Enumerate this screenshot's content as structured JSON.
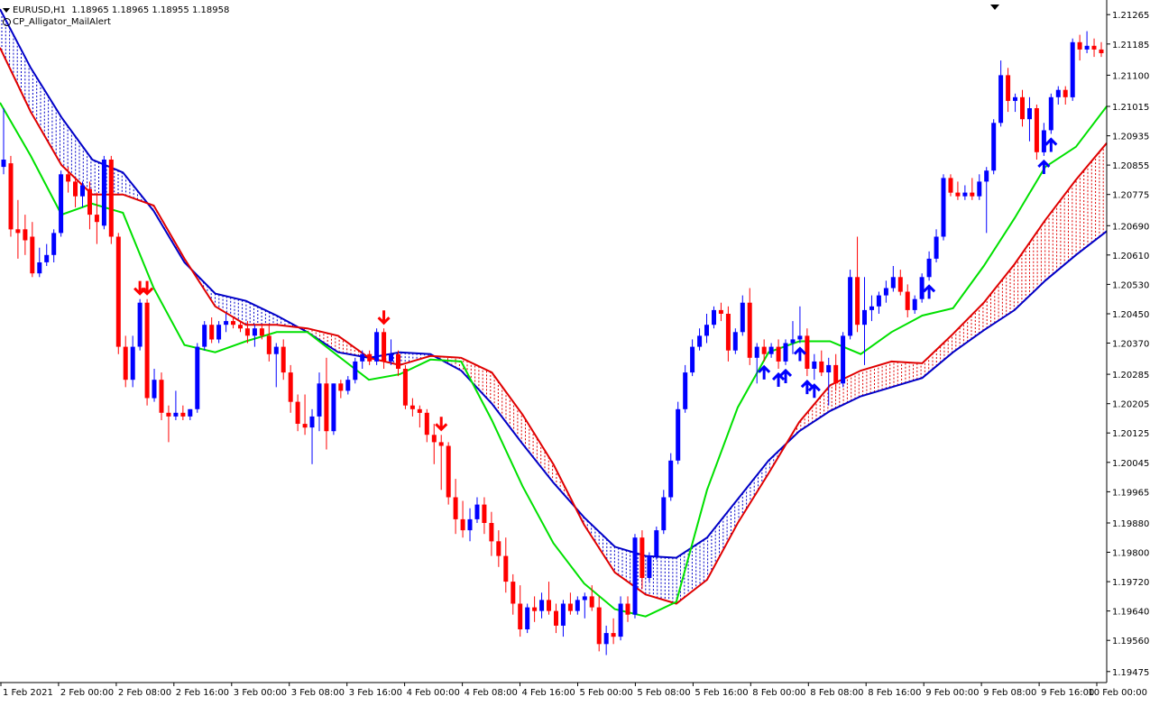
{
  "header": {
    "symbol_line": "EURUSD,H1  1.18965 1.18965 1.18955 1.18958",
    "indicator_name": "CP_Alligator_MailAlert"
  },
  "colors": {
    "bull_candle": "#0000ff",
    "bear_candle": "#ff0000",
    "jaw": "#0000c8",
    "teeth": "#e00000",
    "lips": "#00e000",
    "arrow_down": "#ff0000",
    "arrow_up": "#0000ff",
    "axis": "#000000"
  },
  "chart_data": {
    "type": "candlestick",
    "symbol": "EURUSD",
    "timeframe": "H1",
    "ylim": [
      1.19445,
      1.213
    ],
    "y_ticks": [
      "1.21265",
      "1.21185",
      "1.21100",
      "1.21015",
      "1.20935",
      "1.20855",
      "1.20775",
      "1.20690",
      "1.20610",
      "1.20530",
      "1.20450",
      "1.20370",
      "1.20285",
      "1.20205",
      "1.20125",
      "1.20045",
      "1.19965",
      "1.19880",
      "1.19800",
      "1.19720",
      "1.19640",
      "1.19560",
      "1.19475"
    ],
    "x_ticks": [
      "1 Feb 2021",
      "2 Feb 00:00",
      "2 Feb 08:00",
      "2 Feb 16:00",
      "3 Feb 00:00",
      "3 Feb 08:00",
      "3 Feb 16:00",
      "4 Feb 00:00",
      "4 Feb 08:00",
      "4 Feb 16:00",
      "5 Feb 00:00",
      "5 Feb 08:00",
      "5 Feb 16:00",
      "8 Feb 00:00",
      "8 Feb 08:00",
      "8 Feb 16:00",
      "9 Feb 00:00",
      "9 Feb 08:00",
      "9 Feb 16:00",
      "10 Feb 00:00"
    ],
    "series": [
      {
        "name": "Jaw",
        "values": [
          1.2128,
          1.2112,
          1.20985,
          1.2087,
          1.20835,
          1.2073,
          1.2059,
          1.20505,
          1.20485,
          1.20445,
          1.204,
          1.20345,
          1.2033,
          1.20345,
          1.2034,
          1.20295,
          1.20205,
          1.20095,
          1.1999,
          1.19895,
          1.19815,
          1.1979,
          1.19785,
          1.1984,
          1.19945,
          1.2005,
          1.2013,
          1.20185,
          1.20225,
          1.2025,
          1.20275,
          1.20345,
          1.20405,
          1.2046,
          1.2054,
          1.2061,
          1.20675
        ]
      },
      {
        "name": "Teeth",
        "values": [
          1.21175,
          1.21,
          1.20855,
          1.20775,
          1.20775,
          1.20745,
          1.206,
          1.2047,
          1.2042,
          1.2042,
          1.2041,
          1.2039,
          1.2033,
          1.2031,
          1.20335,
          1.2033,
          1.2029,
          1.20175,
          1.2004,
          1.19875,
          1.19745,
          1.19685,
          1.1966,
          1.19725,
          1.1988,
          1.20015,
          1.20155,
          1.20255,
          1.20295,
          1.2032,
          1.20315,
          1.20395,
          1.2048,
          1.20585,
          1.20705,
          1.20815,
          1.20915
        ]
      },
      {
        "name": "Lips",
        "values": [
          1.21025,
          1.2088,
          1.2072,
          1.2075,
          1.20725,
          1.2052,
          1.20365,
          1.20345,
          1.20375,
          1.204,
          1.204,
          1.20335,
          1.2027,
          1.20285,
          1.20325,
          1.2032,
          1.2016,
          1.1998,
          1.19825,
          1.19715,
          1.19645,
          1.19625,
          1.19665,
          1.1997,
          1.20195,
          1.20345,
          1.20375,
          1.20375,
          1.2034,
          1.204,
          1.20445,
          1.20465,
          1.2058,
          1.2071,
          1.2085,
          1.20905,
          1.21015
        ]
      }
    ],
    "candles": [
      {
        "o": 1.2085,
        "h": 1.2101,
        "l": 1.2083,
        "c": 1.2087
      },
      {
        "o": 1.2086,
        "h": 1.2088,
        "l": 1.2066,
        "c": 1.2068
      },
      {
        "o": 1.2068,
        "h": 1.2076,
        "l": 1.206,
        "c": 1.2067
      },
      {
        "o": 1.2068,
        "h": 1.2072,
        "l": 1.2061,
        "c": 1.2065
      },
      {
        "o": 1.2066,
        "h": 1.207,
        "l": 1.2055,
        "c": 1.2056
      },
      {
        "o": 1.2056,
        "h": 1.2063,
        "l": 1.2055,
        "c": 1.2059
      },
      {
        "o": 1.2059,
        "h": 1.2064,
        "l": 1.2058,
        "c": 1.2061
      },
      {
        "o": 1.2061,
        "h": 1.2068,
        "l": 1.2059,
        "c": 1.2067
      },
      {
        "o": 1.2067,
        "h": 1.2084,
        "l": 1.2066,
        "c": 1.2083
      },
      {
        "o": 1.2083,
        "h": 1.2085,
        "l": 1.2078,
        "c": 1.2081
      },
      {
        "o": 1.2081,
        "h": 1.2082,
        "l": 1.2074,
        "c": 1.2077
      },
      {
        "o": 1.2077,
        "h": 1.2081,
        "l": 1.2074,
        "c": 1.208
      },
      {
        "o": 1.2079,
        "h": 1.2081,
        "l": 1.2068,
        "c": 1.2072
      },
      {
        "o": 1.2072,
        "h": 1.2078,
        "l": 1.2064,
        "c": 1.207
      },
      {
        "o": 1.2069,
        "h": 1.2088,
        "l": 1.2068,
        "c": 1.2087
      },
      {
        "o": 1.2087,
        "h": 1.2088,
        "l": 1.2064,
        "c": 1.2066
      },
      {
        "o": 1.2066,
        "h": 1.2067,
        "l": 1.2034,
        "c": 1.2036
      },
      {
        "o": 1.2036,
        "h": 1.2039,
        "l": 1.2025,
        "c": 1.2027
      },
      {
        "o": 1.2027,
        "h": 1.2039,
        "l": 1.2025,
        "c": 1.2036
      },
      {
        "o": 1.2036,
        "h": 1.2049,
        "l": 1.2035,
        "c": 1.2048
      },
      {
        "o": 1.2048,
        "h": 1.2049,
        "l": 1.202,
        "c": 1.2022
      },
      {
        "o": 1.2022,
        "h": 1.203,
        "l": 1.2021,
        "c": 1.2027
      },
      {
        "o": 1.2027,
        "h": 1.2029,
        "l": 1.2016,
        "c": 1.2018
      },
      {
        "o": 1.2018,
        "h": 1.202,
        "l": 1.201,
        "c": 1.2017
      },
      {
        "o": 1.2017,
        "h": 1.2024,
        "l": 1.2016,
        "c": 1.2018
      },
      {
        "o": 1.2018,
        "h": 1.202,
        "l": 1.2016,
        "c": 1.2017
      },
      {
        "o": 1.2017,
        "h": 1.2019,
        "l": 1.2016,
        "c": 1.2019
      },
      {
        "o": 1.2019,
        "h": 1.2037,
        "l": 1.2018,
        "c": 1.2036
      },
      {
        "o": 1.2036,
        "h": 1.2043,
        "l": 1.2035,
        "c": 1.2042
      },
      {
        "o": 1.2042,
        "h": 1.2044,
        "l": 1.2037,
        "c": 1.2038
      },
      {
        "o": 1.2038,
        "h": 1.2043,
        "l": 1.2037,
        "c": 1.2042
      },
      {
        "o": 1.2042,
        "h": 1.2045,
        "l": 1.204,
        "c": 1.2043
      },
      {
        "o": 1.2043,
        "h": 1.2044,
        "l": 1.2041,
        "c": 1.2042
      },
      {
        "o": 1.2042,
        "h": 1.2043,
        "l": 1.204,
        "c": 1.2041
      },
      {
        "o": 1.2041,
        "h": 1.2043,
        "l": 1.2037,
        "c": 1.2039
      },
      {
        "o": 1.2039,
        "h": 1.2042,
        "l": 1.2036,
        "c": 1.2041
      },
      {
        "o": 1.2041,
        "h": 1.2042,
        "l": 1.2038,
        "c": 1.2039
      },
      {
        "o": 1.2039,
        "h": 1.2042,
        "l": 1.2032,
        "c": 1.2034
      },
      {
        "o": 1.2034,
        "h": 1.2037,
        "l": 1.2025,
        "c": 1.2036
      },
      {
        "o": 1.2036,
        "h": 1.2038,
        "l": 1.2027,
        "c": 1.2029
      },
      {
        "o": 1.2029,
        "h": 1.2031,
        "l": 1.2018,
        "c": 1.2021
      },
      {
        "o": 1.2021,
        "h": 1.2023,
        "l": 1.2013,
        "c": 1.2015
      },
      {
        "o": 1.2015,
        "h": 1.2023,
        "l": 1.2012,
        "c": 1.2014
      },
      {
        "o": 1.2014,
        "h": 1.2019,
        "l": 1.2004,
        "c": 1.2017
      },
      {
        "o": 1.2017,
        "h": 1.2029,
        "l": 1.2013,
        "c": 1.2026
      },
      {
        "o": 1.2026,
        "h": 1.2033,
        "l": 1.2008,
        "c": 1.2013
      },
      {
        "o": 1.2013,
        "h": 1.2026,
        "l": 1.2012,
        "c": 1.2026
      },
      {
        "o": 1.2026,
        "h": 1.2027,
        "l": 1.2022,
        "c": 1.2024
      },
      {
        "o": 1.2024,
        "h": 1.2028,
        "l": 1.2023,
        "c": 1.2027
      },
      {
        "o": 1.2027,
        "h": 1.2033,
        "l": 1.2026,
        "c": 1.2032
      },
      {
        "o": 1.2032,
        "h": 1.2035,
        "l": 1.203,
        "c": 1.2034
      },
      {
        "o": 1.2034,
        "h": 1.2035,
        "l": 1.2031,
        "c": 1.2032
      },
      {
        "o": 1.2032,
        "h": 1.2041,
        "l": 1.2031,
        "c": 1.204
      },
      {
        "o": 1.204,
        "h": 1.2041,
        "l": 1.203,
        "c": 1.2032
      },
      {
        "o": 1.2032,
        "h": 1.2038,
        "l": 1.2031,
        "c": 1.2034
      },
      {
        "o": 1.2034,
        "h": 1.2035,
        "l": 1.2028,
        "c": 1.203
      },
      {
        "o": 1.203,
        "h": 1.2031,
        "l": 1.2019,
        "c": 1.202
      },
      {
        "o": 1.202,
        "h": 1.2022,
        "l": 1.2017,
        "c": 1.2019
      },
      {
        "o": 1.2019,
        "h": 1.202,
        "l": 1.2014,
        "c": 1.2018
      },
      {
        "o": 1.2018,
        "h": 1.2019,
        "l": 1.201,
        "c": 1.2012
      },
      {
        "o": 1.2012,
        "h": 1.2015,
        "l": 1.2004,
        "c": 1.201
      },
      {
        "o": 1.201,
        "h": 1.2012,
        "l": 1.1997,
        "c": 1.2009
      },
      {
        "o": 1.2009,
        "h": 1.201,
        "l": 1.1993,
        "c": 1.1995
      },
      {
        "o": 1.1995,
        "h": 1.2,
        "l": 1.1985,
        "c": 1.1989
      },
      {
        "o": 1.1989,
        "h": 1.1994,
        "l": 1.1984,
        "c": 1.1986
      },
      {
        "o": 1.1986,
        "h": 1.1992,
        "l": 1.1983,
        "c": 1.1989
      },
      {
        "o": 1.1989,
        "h": 1.1995,
        "l": 1.1988,
        "c": 1.1993
      },
      {
        "o": 1.1993,
        "h": 1.1995,
        "l": 1.1985,
        "c": 1.1988
      },
      {
        "o": 1.1988,
        "h": 1.1991,
        "l": 1.1979,
        "c": 1.1983
      },
      {
        "o": 1.1983,
        "h": 1.1986,
        "l": 1.1976,
        "c": 1.1979
      },
      {
        "o": 1.1979,
        "h": 1.1984,
        "l": 1.1969,
        "c": 1.1972
      },
      {
        "o": 1.1972,
        "h": 1.1974,
        "l": 1.1963,
        "c": 1.1966
      },
      {
        "o": 1.1966,
        "h": 1.1971,
        "l": 1.1957,
        "c": 1.1959
      },
      {
        "o": 1.1959,
        "h": 1.1966,
        "l": 1.1958,
        "c": 1.1965
      },
      {
        "o": 1.1965,
        "h": 1.1968,
        "l": 1.1961,
        "c": 1.1964
      },
      {
        "o": 1.1964,
        "h": 1.1969,
        "l": 1.1962,
        "c": 1.1967
      },
      {
        "o": 1.1967,
        "h": 1.1972,
        "l": 1.1963,
        "c": 1.1964
      },
      {
        "o": 1.1964,
        "h": 1.1966,
        "l": 1.1958,
        "c": 1.196
      },
      {
        "o": 1.196,
        "h": 1.1967,
        "l": 1.1957,
        "c": 1.1966
      },
      {
        "o": 1.1966,
        "h": 1.1969,
        "l": 1.1963,
        "c": 1.1964
      },
      {
        "o": 1.1964,
        "h": 1.1968,
        "l": 1.1963,
        "c": 1.1967
      },
      {
        "o": 1.1967,
        "h": 1.1969,
        "l": 1.1962,
        "c": 1.1968
      },
      {
        "o": 1.1968,
        "h": 1.1971,
        "l": 1.1964,
        "c": 1.1965
      },
      {
        "o": 1.1965,
        "h": 1.1968,
        "l": 1.1953,
        "c": 1.1955
      },
      {
        "o": 1.1955,
        "h": 1.196,
        "l": 1.1952,
        "c": 1.1958
      },
      {
        "o": 1.1958,
        "h": 1.1962,
        "l": 1.1955,
        "c": 1.1957
      },
      {
        "o": 1.1957,
        "h": 1.1968,
        "l": 1.1956,
        "c": 1.1966
      },
      {
        "o": 1.1966,
        "h": 1.1968,
        "l": 1.1961,
        "c": 1.1963
      },
      {
        "o": 1.1963,
        "h": 1.1985,
        "l": 1.1962,
        "c": 1.1984
      },
      {
        "o": 1.1984,
        "h": 1.1986,
        "l": 1.197,
        "c": 1.1973
      },
      {
        "o": 1.1973,
        "h": 1.198,
        "l": 1.1972,
        "c": 1.1979
      },
      {
        "o": 1.1979,
        "h": 1.1987,
        "l": 1.1978,
        "c": 1.1986
      },
      {
        "o": 1.1986,
        "h": 1.1997,
        "l": 1.1985,
        "c": 1.1995
      },
      {
        "o": 1.1995,
        "h": 1.2007,
        "l": 1.1994,
        "c": 1.2005
      },
      {
        "o": 1.2005,
        "h": 1.2021,
        "l": 1.2004,
        "c": 1.2019
      },
      {
        "o": 1.2019,
        "h": 1.2031,
        "l": 1.2018,
        "c": 1.2029
      },
      {
        "o": 1.2029,
        "h": 1.2038,
        "l": 1.2028,
        "c": 1.2036
      },
      {
        "o": 1.2036,
        "h": 1.2041,
        "l": 1.2035,
        "c": 1.2039
      },
      {
        "o": 1.2039,
        "h": 1.2045,
        "l": 1.2037,
        "c": 1.2042
      },
      {
        "o": 1.2042,
        "h": 1.2047,
        "l": 1.2041,
        "c": 1.2046
      },
      {
        "o": 1.2046,
        "h": 1.2048,
        "l": 1.2043,
        "c": 1.2045
      },
      {
        "o": 1.2045,
        "h": 1.2047,
        "l": 1.2032,
        "c": 1.2035
      },
      {
        "o": 1.2035,
        "h": 1.2041,
        "l": 1.2034,
        "c": 1.204
      },
      {
        "o": 1.204,
        "h": 1.205,
        "l": 1.2039,
        "c": 1.2048
      },
      {
        "o": 1.2048,
        "h": 1.2052,
        "l": 1.2031,
        "c": 1.2033
      },
      {
        "o": 1.2033,
        "h": 1.2037,
        "l": 1.2026,
        "c": 1.2036
      },
      {
        "o": 1.2036,
        "h": 1.2038,
        "l": 1.2032,
        "c": 1.2034
      },
      {
        "o": 1.2034,
        "h": 1.2037,
        "l": 1.2033,
        "c": 1.2036
      },
      {
        "o": 1.2036,
        "h": 1.2038,
        "l": 1.203,
        "c": 1.2032
      },
      {
        "o": 1.2032,
        "h": 1.2038,
        "l": 1.2031,
        "c": 1.2037
      },
      {
        "o": 1.2037,
        "h": 1.2043,
        "l": 1.2034,
        "c": 1.2038
      },
      {
        "o": 1.2038,
        "h": 1.2047,
        "l": 1.2037,
        "c": 1.2039
      },
      {
        "o": 1.2039,
        "h": 1.2041,
        "l": 1.2028,
        "c": 1.203
      },
      {
        "o": 1.203,
        "h": 1.2034,
        "l": 1.2027,
        "c": 1.2032
      },
      {
        "o": 1.2032,
        "h": 1.2035,
        "l": 1.2028,
        "c": 1.2029
      },
      {
        "o": 1.2029,
        "h": 1.2033,
        "l": 1.202,
        "c": 1.2031
      },
      {
        "o": 1.2031,
        "h": 1.2034,
        "l": 1.2024,
        "c": 1.2026
      },
      {
        "o": 1.2026,
        "h": 1.204,
        "l": 1.2025,
        "c": 1.2039
      },
      {
        "o": 1.2039,
        "h": 1.2057,
        "l": 1.2038,
        "c": 1.2055
      },
      {
        "o": 1.2055,
        "h": 1.2066,
        "l": 1.204,
        "c": 1.2042
      },
      {
        "o": 1.2042,
        "h": 1.2055,
        "l": 1.2031,
        "c": 1.2046
      },
      {
        "o": 1.2046,
        "h": 1.205,
        "l": 1.2043,
        "c": 1.2047
      },
      {
        "o": 1.2047,
        "h": 1.2051,
        "l": 1.2045,
        "c": 1.205
      },
      {
        "o": 1.205,
        "h": 1.2054,
        "l": 1.2048,
        "c": 1.2052
      },
      {
        "o": 1.2052,
        "h": 1.2058,
        "l": 1.2051,
        "c": 1.2055
      },
      {
        "o": 1.2055,
        "h": 1.2057,
        "l": 1.205,
        "c": 1.2051
      },
      {
        "o": 1.2051,
        "h": 1.2053,
        "l": 1.2044,
        "c": 1.2046
      },
      {
        "o": 1.2046,
        "h": 1.205,
        "l": 1.2045,
        "c": 1.2049
      },
      {
        "o": 1.2049,
        "h": 1.2056,
        "l": 1.2048,
        "c": 1.2055
      },
      {
        "o": 1.2055,
        "h": 1.2062,
        "l": 1.2054,
        "c": 1.206
      },
      {
        "o": 1.206,
        "h": 1.2068,
        "l": 1.2059,
        "c": 1.2066
      },
      {
        "o": 1.2066,
        "h": 1.2083,
        "l": 1.2065,
        "c": 1.2082
      },
      {
        "o": 1.2082,
        "h": 1.2083,
        "l": 1.2077,
        "c": 1.2078
      },
      {
        "o": 1.2078,
        "h": 1.2081,
        "l": 1.2076,
        "c": 1.2077
      },
      {
        "o": 1.2077,
        "h": 1.208,
        "l": 1.2076,
        "c": 1.2078
      },
      {
        "o": 1.2078,
        "h": 1.2082,
        "l": 1.2076,
        "c": 1.2077
      },
      {
        "o": 1.2077,
        "h": 1.2083,
        "l": 1.2076,
        "c": 1.2081
      },
      {
        "o": 1.2081,
        "h": 1.2085,
        "l": 1.2067,
        "c": 1.2084
      },
      {
        "o": 1.2084,
        "h": 1.2098,
        "l": 1.2083,
        "c": 1.2097
      },
      {
        "o": 1.2097,
        "h": 1.2114,
        "l": 1.2096,
        "c": 1.211
      },
      {
        "o": 1.211,
        "h": 1.2112,
        "l": 1.21,
        "c": 1.2103
      },
      {
        "o": 1.2103,
        "h": 1.2105,
        "l": 1.21,
        "c": 1.2104
      },
      {
        "o": 1.2104,
        "h": 1.2106,
        "l": 1.2096,
        "c": 1.2098
      },
      {
        "o": 1.2098,
        "h": 1.2104,
        "l": 1.2092,
        "c": 1.2101
      },
      {
        "o": 1.2101,
        "h": 1.2102,
        "l": 1.2087,
        "c": 1.2089
      },
      {
        "o": 1.2089,
        "h": 1.2097,
        "l": 1.2088,
        "c": 1.2095
      },
      {
        "o": 1.2095,
        "h": 1.2105,
        "l": 1.2094,
        "c": 1.2104
      },
      {
        "o": 1.2104,
        "h": 1.2107,
        "l": 1.2102,
        "c": 1.2106
      },
      {
        "o": 1.2106,
        "h": 1.2107,
        "l": 1.2102,
        "c": 1.2104
      },
      {
        "o": 1.2104,
        "h": 1.212,
        "l": 1.2103,
        "c": 1.2119
      },
      {
        "o": 1.2119,
        "h": 1.2121,
        "l": 1.2114,
        "c": 1.2117
      },
      {
        "o": 1.2117,
        "h": 1.2122,
        "l": 1.2116,
        "c": 1.2118
      },
      {
        "o": 1.2118,
        "h": 1.212,
        "l": 1.2115,
        "c": 1.2117
      },
      {
        "o": 1.2117,
        "h": 1.2119,
        "l": 1.2115,
        "c": 1.2116
      }
    ],
    "down_arrow_candles": [
      19,
      20,
      53,
      61
    ],
    "up_arrow_candles": [
      106,
      108,
      109,
      111,
      112,
      113,
      129,
      145,
      146
    ],
    "grid": false,
    "legend": "none"
  }
}
